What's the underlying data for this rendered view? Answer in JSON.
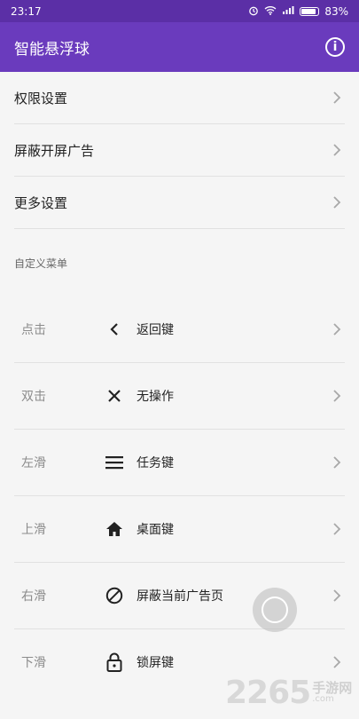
{
  "statusbar": {
    "time": "23:17",
    "battery": "83%"
  },
  "appbar": {
    "title": "智能悬浮球"
  },
  "settings": [
    {
      "label": "权限设置"
    },
    {
      "label": "屏蔽开屏广告"
    },
    {
      "label": "更多设置"
    }
  ],
  "custom_menu": {
    "title": "自定义菜单",
    "items": [
      {
        "gesture": "点击",
        "icon": "back-chevron-icon",
        "action": "返回键"
      },
      {
        "gesture": "双击",
        "icon": "close-x-icon",
        "action": "无操作"
      },
      {
        "gesture": "左滑",
        "icon": "menu-lines-icon",
        "action": "任务键"
      },
      {
        "gesture": "上滑",
        "icon": "home-icon",
        "action": "桌面键"
      },
      {
        "gesture": "右滑",
        "icon": "block-icon",
        "action": "屏蔽当前广告页"
      },
      {
        "gesture": "下滑",
        "icon": "lock-icon",
        "action": "锁屏键"
      }
    ]
  },
  "watermark": {
    "number": "2265",
    "cn": "手游网",
    "com": ".com"
  },
  "colors": {
    "status": "#5b2fa6",
    "appbar": "#6a3bbd",
    "background": "#f5f5f5"
  }
}
